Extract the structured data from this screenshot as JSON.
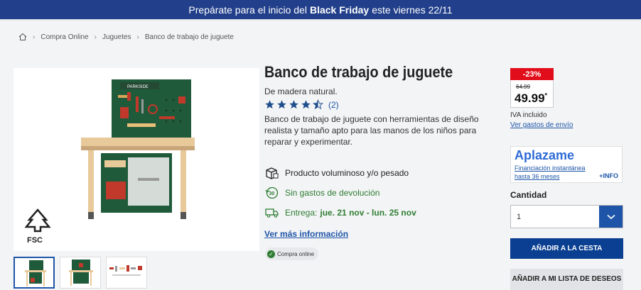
{
  "promo": {
    "before": "Prepárate para el inicio del",
    "bold": "Black Friday",
    "after": "este viernes 22/11"
  },
  "breadcrumb": {
    "items": [
      "Compra Online",
      "Juguetes",
      "Banco de trabajo de juguete"
    ]
  },
  "product": {
    "title": "Banco de trabajo de juguete",
    "subtitle": "De madera natural.",
    "rating": {
      "value": 4.5,
      "count": "(2)"
    },
    "description": "Banco de trabajo de juguete con herramientas de diseño realista y tamaño apto para las manos de los niños para reparar y experimentar.",
    "image": {
      "brand": "PARKSIDE",
      "logo": "FSC"
    },
    "thumbnails": [
      {
        "label": "thumb-1"
      },
      {
        "label": "thumb-2"
      },
      {
        "label": "thumb-3"
      }
    ]
  },
  "features": {
    "bulky": "Producto voluminoso y/o pesado",
    "returns": "Sin gastos de devolución",
    "returns_icon_text": "30",
    "delivery_label": "Entrega:",
    "delivery_dates": "jue. 21 nov - lun. 25 nov"
  },
  "more_info": "Ver más información",
  "online_badge": "Compra online",
  "pricing": {
    "discount": "-23%",
    "old_price": "64.99",
    "price": "49.99",
    "price_suffix": "*",
    "vat": "IVA incluido",
    "shipping_link": "Ver gastos de envío"
  },
  "aplazame": {
    "logo": "Aplazame",
    "line1": "Financiación instantánea",
    "line2": "hasta 36 meses",
    "info": "+INFO"
  },
  "quantity": {
    "label": "Cantidad",
    "value": "1"
  },
  "buttons": {
    "add_to_cart": "AÑADIR A LA CESTA",
    "add_to_wishlist": "AÑADIR A MI LISTA DE DESEOS"
  },
  "colors": {
    "banner": "#213f8a",
    "primary": "#0a3f91",
    "link": "#1e55a8",
    "sale": "#e10d1a",
    "green": "#2e7d32"
  }
}
